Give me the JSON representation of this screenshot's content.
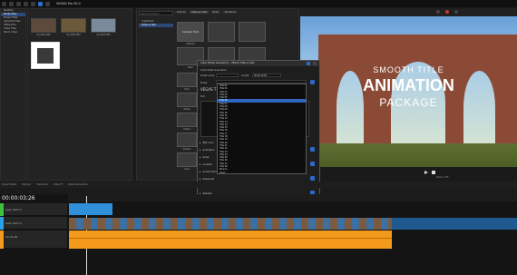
{
  "window": {
    "title": "VEGAS Pro 20.0"
  },
  "left_panel": {
    "tree": [
      "Desktop",
      "Media Files",
      "Project Files",
      "Imported Files",
      "VEGAS Pro",
      "Video Files",
      "Stock Video"
    ],
    "thumbnails": [
      {
        "label": "DJI_0001.MP4"
      },
      {
        "label": "DJI_0002.MP4"
      },
      {
        "label": "DJI_0003.MP4"
      },
      {
        "label": ""
      }
    ]
  },
  "generators": {
    "search_placeholder": "Search Generators",
    "categories": [
      "Credit Roll",
      "Titles & Text"
    ],
    "tabs": [
      "Explorer",
      "Titles and Text",
      "Media",
      "Transitions"
    ],
    "tiles": [
      {
        "text": "Sample Text",
        "label": "(Default)"
      },
      {
        "text": "",
        "label": ""
      },
      {
        "text": "",
        "label": ""
      },
      {
        "text": "",
        "label": "Basic"
      },
      {
        "text": "",
        "label": ""
      },
      {
        "text": "",
        "label": ""
      }
    ],
    "side_labels": [
      "Basic",
      "Fade",
      "Stroke",
      "Outline",
      "Shadow",
      "Glow",
      "Zoom"
    ]
  },
  "preview": {
    "line1": "SMOOTH TITLE",
    "line2": "ANIMATION",
    "line3": "PACKAGE",
    "frame": "Frame: 135",
    "display": "Display: 1920x1080x32"
  },
  "dialog": {
    "title": "Video Media Generators - VEGAS Titles & Text",
    "header": "Video Media Generators",
    "tab_label": "VEGAS Titles & Text",
    "preset_label": "Preset name:",
    "length_label": "Length:",
    "length_value": "00:00:10;00",
    "preset_value": "VEGAS T",
    "text_label": "Text",
    "section_labels": [
      "Text color",
      "Animation",
      "Scale",
      "Location",
      "Anchor Point",
      "Advanced",
      "Outline",
      "Shadow"
    ],
    "dropdown_items": [
      "Title 01",
      "Title 02",
      "Title 03",
      "Title 04",
      "Title 05",
      "Title 06",
      "Title 07",
      "Title 08",
      "Title 09",
      "Title 10",
      "Title 11",
      "Title 12",
      "Title 13",
      "Title 14",
      "Title 15",
      "Title 16",
      "Title 17",
      "Title 18",
      "Title 19",
      "Title 20",
      "Title 21",
      "Title 22",
      "Title 23",
      "Title 24",
      "Title 25",
      "Title 26",
      "Title 27",
      "Title 28",
      "Bounce",
      "Zoom",
      "Pop In",
      "Floating",
      "Typewriter",
      "Slide In",
      "Fade In",
      "Wipe",
      "Spin",
      "Flip",
      "Glitch",
      "Reveal"
    ],
    "selected_index": 5
  },
  "timeline": {
    "time": "00:00:03;26",
    "tracks": [
      {
        "name": "Level: 100.0 %",
        "color": "#3ec23e"
      },
      {
        "name": "Level: 100.0 %",
        "color": "#2aa0e8"
      },
      {
        "name": "Vol: 0.0 dB",
        "color": "#f39a1c"
      }
    ],
    "status": "Complete: 00:00:01",
    "tabs": [
      "Project Media",
      "Explorer",
      "Transitions",
      "Video FX",
      "Media Generators"
    ]
  }
}
